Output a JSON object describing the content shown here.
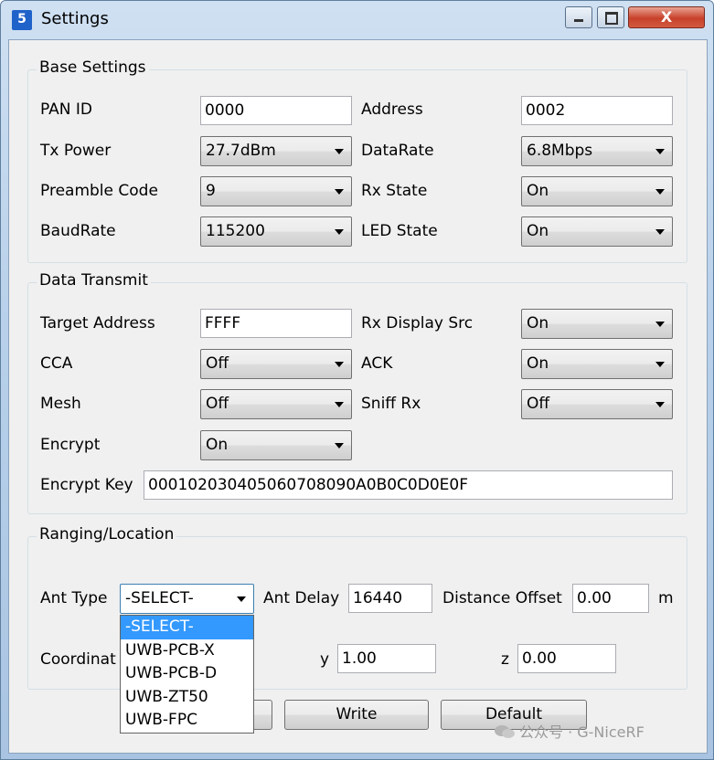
{
  "window": {
    "title": "Settings",
    "icon_glyph": "5",
    "min_glyph": "",
    "max_glyph": "",
    "close_glyph": "X"
  },
  "base": {
    "title": "Base Settings",
    "pan_id": {
      "label": "PAN ID",
      "value": "0000"
    },
    "address": {
      "label": "Address",
      "value": "0002"
    },
    "tx_power": {
      "label": "Tx Power",
      "value": "27.7dBm"
    },
    "data_rate": {
      "label": "DataRate",
      "value": "6.8Mbps"
    },
    "preamble": {
      "label": "Preamble Code",
      "value": "9"
    },
    "rx_state": {
      "label": "Rx State",
      "value": "On"
    },
    "baud": {
      "label": "BaudRate",
      "value": "115200"
    },
    "led": {
      "label": "LED State",
      "value": "On"
    }
  },
  "transmit": {
    "title": "Data Transmit",
    "target": {
      "label": "Target Address",
      "value": "FFFF"
    },
    "rx_display": {
      "label": "Rx Display Src",
      "value": "On"
    },
    "cca": {
      "label": "CCA",
      "value": "Off"
    },
    "ack": {
      "label": "ACK",
      "value": "On"
    },
    "mesh": {
      "label": "Mesh",
      "value": "Off"
    },
    "sniff": {
      "label": "Sniff Rx",
      "value": "Off"
    },
    "encrypt": {
      "label": "Encrypt",
      "value": "On"
    },
    "key": {
      "label": "Encrypt Key",
      "value": "000102030405060708090A0B0C0D0E0F"
    }
  },
  "ranging": {
    "title": "Ranging/Location",
    "ant_type": {
      "label": "Ant Type",
      "value": "-SELECT-"
    },
    "ant_delay": {
      "label": "Ant Delay",
      "value": "16440"
    },
    "offset": {
      "label": "Distance Offset",
      "value": "0.00",
      "unit": "m"
    },
    "coord": {
      "label": "Coordinat"
    },
    "y": {
      "label": "y",
      "value": "1.00"
    },
    "z": {
      "label": "z",
      "value": "0.00"
    }
  },
  "ant_options": [
    "-SELECT-",
    "UWB-PCB-X",
    "UWB-PCB-D",
    "UWB-ZT50",
    "UWB-FPC"
  ],
  "buttons": {
    "write": "Write",
    "default": "Default"
  },
  "watermark": "公众号 · G-NiceRF"
}
